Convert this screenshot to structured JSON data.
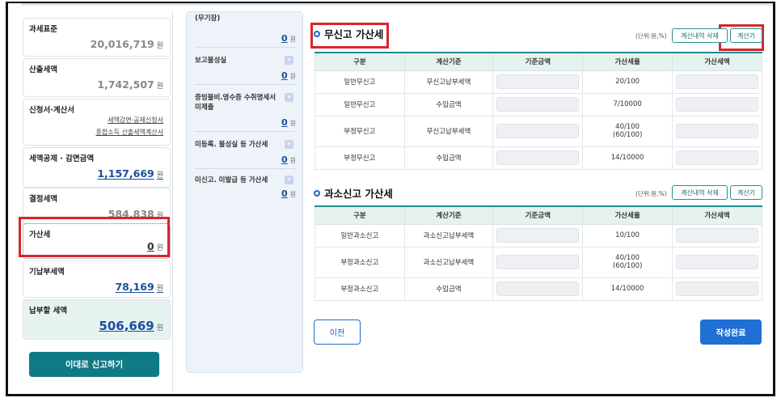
{
  "left_cards": [
    {
      "label": "과세표준",
      "value": "20,016,719",
      "unit": "원"
    },
    {
      "label": "산출세액",
      "value": "1,742,507",
      "unit": "원"
    },
    {
      "label": "신청서·계산서",
      "links": [
        "세액감면·공제신청서",
        "종합소득 산출세액계산서"
      ]
    },
    {
      "label": "세액공제 · 감면금액",
      "value": "1,157,669",
      "unit": "원"
    },
    {
      "label": "결정세액",
      "value": "584,838",
      "unit": "원"
    },
    {
      "label": "가산세",
      "value": "0",
      "unit": "원"
    },
    {
      "label": "기납부세액",
      "value": "78,169",
      "unit": "원"
    },
    {
      "label": "납부할 세액",
      "value": "506,669",
      "unit": "원"
    }
  ],
  "submit_button": "이대로 신고하기",
  "mid_items": [
    {
      "label": "(무기장)",
      "value": "0",
      "unit": "원"
    },
    {
      "label": "보고불성실",
      "value": "0",
      "unit": "원"
    },
    {
      "label": "증빙불비.영수증 수취명세서 미제출",
      "value": "0",
      "unit": "원"
    },
    {
      "label": "미등록. 불성실 등 가산세",
      "value": "0",
      "unit": "원"
    },
    {
      "label": "미신고. 미발급 등 가산세",
      "value": "0",
      "unit": "원"
    }
  ],
  "chevron": "▾",
  "section1": {
    "title": "무신고 가산세",
    "unit": "(단위:원,%)",
    "delete_btn": "계산내역 삭제",
    "calc_btn": "계산기",
    "headers": [
      "구분",
      "계산기준",
      "기준금액",
      "가산세율",
      "가산세액"
    ],
    "rows": [
      {
        "type": "일반무신고",
        "basis": "무신고납부세액",
        "rate": [
          "20/100"
        ]
      },
      {
        "type": "일반무신고",
        "basis": "수입금액",
        "rate": [
          "7/10000"
        ]
      },
      {
        "type": "부정무신고",
        "basis": "무신고납부세액",
        "rate": [
          "40/100",
          "(60/100)"
        ]
      },
      {
        "type": "부정무신고",
        "basis": "수입금액",
        "rate": [
          "14/10000"
        ]
      }
    ]
  },
  "section2": {
    "title": "과소신고 가산세",
    "unit": "(단위:원,%)",
    "delete_btn": "계산내역 삭제",
    "calc_btn": "계산기",
    "headers": [
      "구분",
      "계산기준",
      "기준금액",
      "가산세율",
      "가산세액"
    ],
    "rows": [
      {
        "type": "일반과소신고",
        "basis": "과소신고납부세액",
        "rate": [
          "10/100"
        ]
      },
      {
        "type": "부정과소신고",
        "basis": "과소신고납부세액",
        "rate": [
          "40/100",
          "(60/100)"
        ]
      },
      {
        "type": "부정과소신고",
        "basis": "수입금액",
        "rate": [
          "14/10000"
        ]
      }
    ]
  },
  "prev_button": "이전",
  "done_button": "작성완료",
  "colors": {
    "accent_teal": "#0f7a86",
    "highlight_red": "#d9252a",
    "link_blue": "#1c4e9a",
    "primary_blue": "#1f6fd4"
  }
}
